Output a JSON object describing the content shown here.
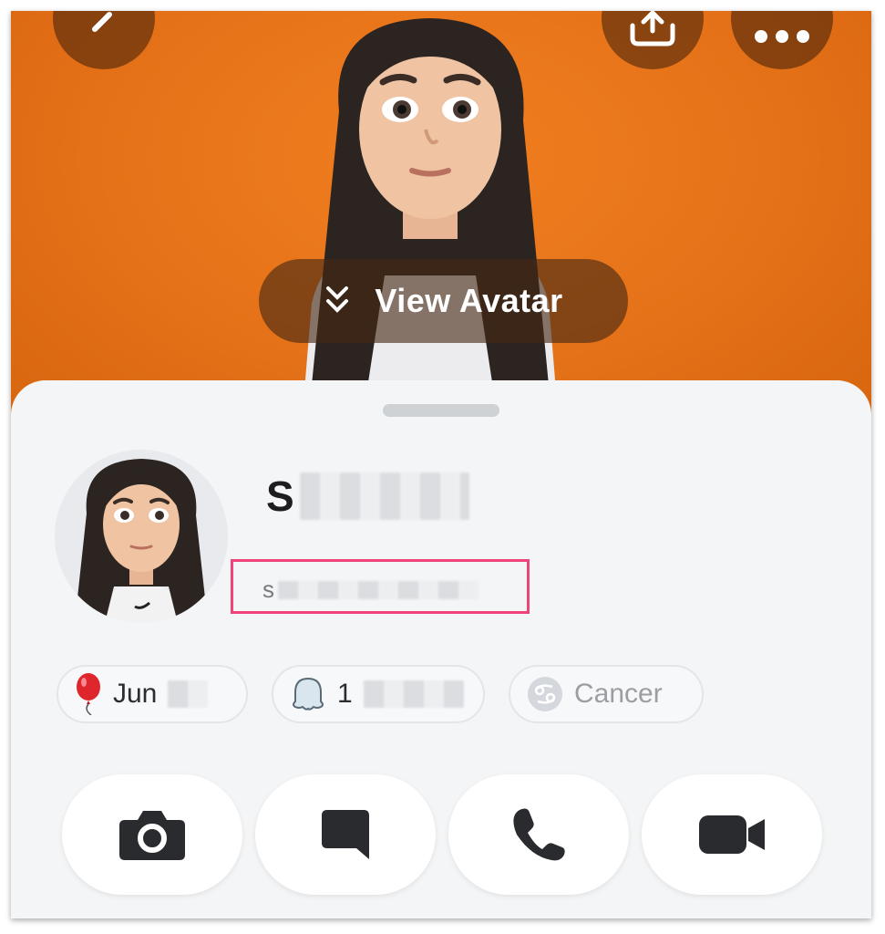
{
  "header": {
    "view_avatar_label": "View Avatar"
  },
  "profile": {
    "display_name_initial": "S",
    "username_prefix": "s",
    "username_highlight_color": "#f0437a"
  },
  "chips": [
    {
      "icon": "balloon-icon",
      "label": "Jun"
    },
    {
      "icon": "ghost-icon",
      "label": "1"
    },
    {
      "icon": "cancer-zodiac-icon",
      "label": "Cancer"
    }
  ],
  "actions": [
    {
      "name": "camera-button",
      "icon": "camera-icon"
    },
    {
      "name": "chat-button",
      "icon": "chat-icon"
    },
    {
      "name": "call-button",
      "icon": "phone-icon"
    },
    {
      "name": "video-call-button",
      "icon": "video-camera-icon"
    }
  ],
  "colors": {
    "hero_background": "#e8741a",
    "sheet_background": "#f4f5f6"
  }
}
